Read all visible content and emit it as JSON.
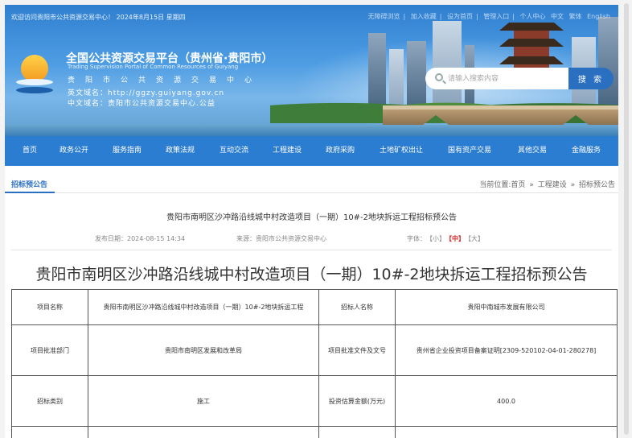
{
  "header": {
    "welcome": "欢迎访问贵阳市公共资源交易中心！ 2024年8月15日 星期四",
    "top_links": [
      "无障碍浏览",
      "加入收藏",
      "设为首页",
      "管理入口",
      "个人中心",
      "中文",
      "繁体",
      "English"
    ],
    "site_title": "全国公共资源交易平台（贵州省·贵阳市）",
    "site_subtitle": "Trading Supervision Portal of Common Resources of Guiyang",
    "site_name_spaced": "贵阳市公共资源交易中心",
    "en_domain": "英文域名：http://ggzy.guiyang.gov.cn",
    "cn_domain": "中文域名：贵阳市公共资源交易中心.公益",
    "search_placeholder": "请输入搜索内容",
    "search_button": "搜 索"
  },
  "nav": {
    "items": [
      "首页",
      "政务公开",
      "服务指南",
      "政策法规",
      "互动交流",
      "工程建设",
      "政府采购",
      "土地矿权出让",
      "国有资产交易",
      "其他交易",
      "金融服务"
    ]
  },
  "crumbbar": {
    "section": "招标预公告",
    "prefix": "当前位置:",
    "path": [
      "首页",
      "工程建设",
      "招标预公告"
    ],
    "separator": "»"
  },
  "article": {
    "title_small": "贵阳市南明区沙冲路沿线城中村改造项目（一期）10#-2地块拆运工程招标预公告",
    "publish_date": "发布日期：2024-08-15 14:34",
    "source": "来源：贵阳市公共资源交易中心",
    "font_label": "字体：",
    "font_sizes": [
      "【小】",
      "【中】",
      "【大】"
    ],
    "title": "贵阳市南明区沙冲路沿线城中村改造项目（一期）10#-2地块拆运工程招标预公告"
  },
  "table": {
    "rows": [
      [
        "项目名称",
        "贵阳市南明区沙冲路沿线城中村改造项目（一期）10#-2地块拆运工程",
        "招标人名称",
        "贵阳中南城市发展有限公司"
      ],
      [
        "项目批准部门",
        "贵阳市南明区发展和改革局",
        "项目批准文件及文号",
        "贵州省企业投资项目备案证明[2309-520102-04-01-280278]"
      ],
      [
        "招标类别",
        "施工",
        "投资估算金额(万元)",
        "400.0"
      ],
      [
        "",
        "",
        "",
        ""
      ]
    ]
  }
}
